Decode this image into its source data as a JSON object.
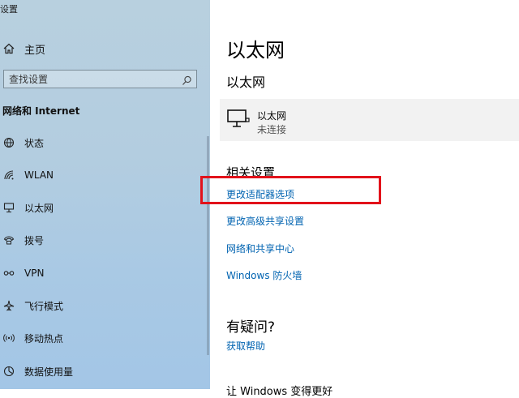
{
  "window": {
    "title": "设置"
  },
  "sidebar": {
    "home_label": "主页",
    "search_placeholder": "查找设置",
    "section_title": "网络和 Internet",
    "items": [
      {
        "label": "状态",
        "icon": "status-icon"
      },
      {
        "label": "WLAN",
        "icon": "wifi-icon"
      },
      {
        "label": "以太网",
        "icon": "ethernet-icon"
      },
      {
        "label": "拨号",
        "icon": "dialup-icon"
      },
      {
        "label": "VPN",
        "icon": "vpn-icon"
      },
      {
        "label": "飞行模式",
        "icon": "airplane-icon"
      },
      {
        "label": "移动热点",
        "icon": "hotspot-icon"
      },
      {
        "label": "数据使用量",
        "icon": "data-usage-icon"
      }
    ]
  },
  "main": {
    "page_title": "以太网",
    "sub_title": "以太网",
    "adapter": {
      "name": "以太网",
      "status": "未连接"
    },
    "related_title": "相关设置",
    "links": [
      {
        "label": "更改适配器选项"
      },
      {
        "label": "更改高级共享设置"
      },
      {
        "label": "网络和共享中心"
      },
      {
        "label": "Windows 防火墙"
      }
    ],
    "faq_title": "有疑问?",
    "faq_link": "获取帮助",
    "cutoff_text": "让 Windows 变得更好"
  },
  "colors": {
    "link": "#0063b1",
    "highlight": "#e2121b",
    "sidebar_bg": "#b3cde0"
  }
}
